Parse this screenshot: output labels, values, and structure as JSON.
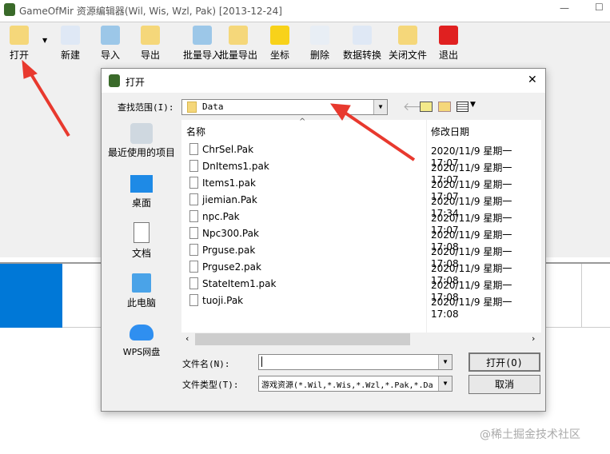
{
  "app": {
    "title": "GameOfMir 资源编辑器(Wil, Wis, Wzl, Pak) [2013-12-24]",
    "minimize": "—",
    "maximize": "☐"
  },
  "toolbar": [
    {
      "label": "打开",
      "icon": "folder-open-icon"
    },
    {
      "label": "新建",
      "icon": "new-file-icon"
    },
    {
      "label": "导入",
      "icon": "import-icon"
    },
    {
      "label": "导出",
      "icon": "export-icon"
    },
    {
      "label": "批量导入",
      "icon": "batch-import-icon"
    },
    {
      "label": "批量导出",
      "icon": "batch-export-icon"
    },
    {
      "label": "坐标",
      "icon": "star-icon"
    },
    {
      "label": "删除",
      "icon": "delete-icon"
    },
    {
      "label": "数据转换",
      "icon": "convert-icon"
    },
    {
      "label": "关闭文件",
      "icon": "close-file-icon"
    },
    {
      "label": "退出",
      "icon": "exit-icon"
    }
  ],
  "dialog": {
    "title": "打开",
    "close": "✕",
    "look_in_label": "查找范围(I):",
    "look_in_value": "Data",
    "places": [
      "最近使用的项目",
      "桌面",
      "文档",
      "此电脑",
      "WPS网盘"
    ],
    "columns": {
      "name": "名称",
      "date": "修改日期"
    },
    "files": [
      {
        "name": "ChrSel.Pak",
        "date": "2020/11/9 星期一 17:07"
      },
      {
        "name": "DnItems1.pak",
        "date": "2020/11/9 星期一 17:07"
      },
      {
        "name": "Items1.pak",
        "date": "2020/11/9 星期一 17:07"
      },
      {
        "name": "jiemian.Pak",
        "date": "2020/11/9 星期一 17:34"
      },
      {
        "name": "npc.Pak",
        "date": "2020/11/9 星期一 17:07"
      },
      {
        "name": "Npc300.Pak",
        "date": "2020/11/9 星期一 17:08"
      },
      {
        "name": "Prguse.pak",
        "date": "2020/11/9 星期一 17:08"
      },
      {
        "name": "Prguse2.pak",
        "date": "2020/11/9 星期一 17:08"
      },
      {
        "name": "StateItem1.pak",
        "date": "2020/11/9 星期一 17:08"
      },
      {
        "name": "tuoji.Pak",
        "date": "2020/11/9 星期一 17:08"
      }
    ],
    "filename_label": "文件名(N):",
    "filename_value": "",
    "filetype_label": "文件类型(T):",
    "filetype_value": "游戏资源(*.Wil,*.Wis,*.Wzl,*.Pak,*.Da",
    "open_button": "打开(O)",
    "cancel_button": "取消"
  },
  "watermark": "@稀土掘金技术社区"
}
